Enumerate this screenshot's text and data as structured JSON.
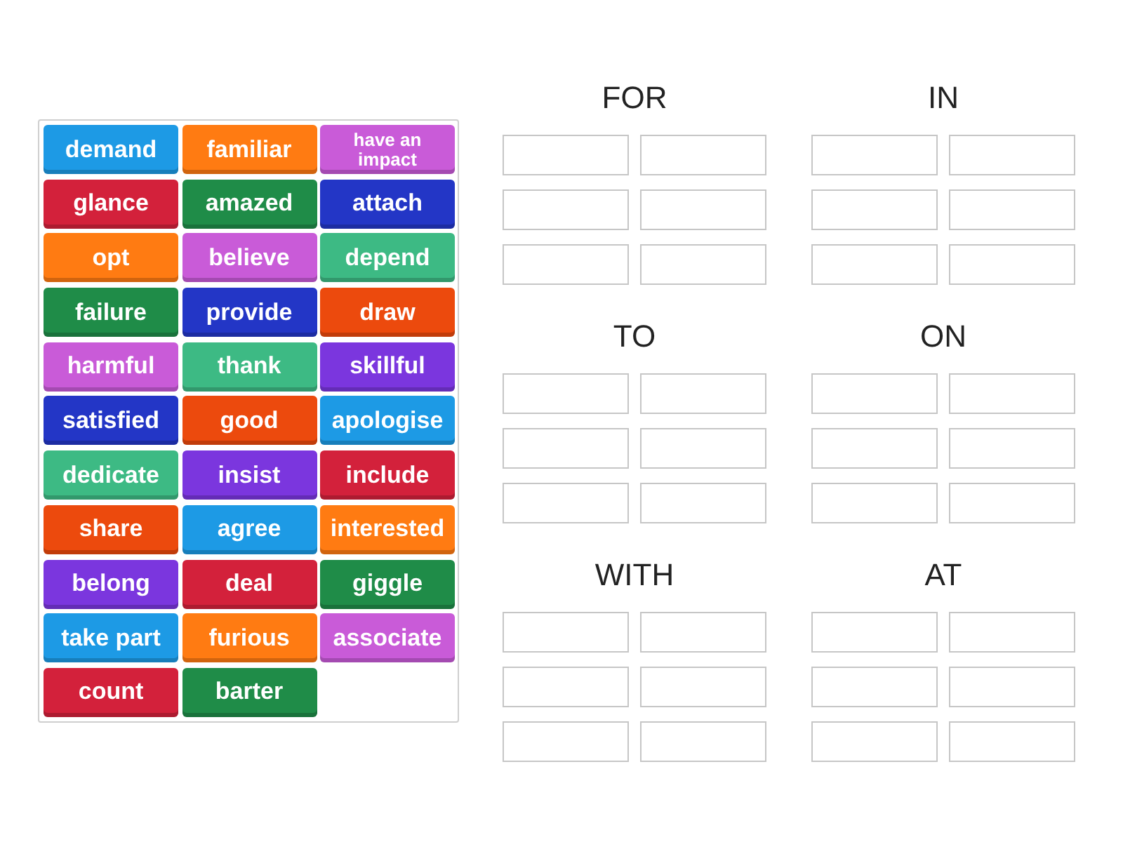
{
  "word_tiles": [
    {
      "text": "demand",
      "color": "#1d9ae5",
      "kind": "regular"
    },
    {
      "text": "familiar",
      "color": "#ff7b12",
      "kind": "regular"
    },
    {
      "text": "have an impact",
      "color": "#c95bd8",
      "kind": "compact"
    },
    {
      "text": "glance",
      "color": "#d3213b",
      "kind": "regular"
    },
    {
      "text": "amazed",
      "color": "#1f8c48",
      "kind": "regular"
    },
    {
      "text": "attach",
      "color": "#2336c6",
      "kind": "regular"
    },
    {
      "text": "opt",
      "color": "#ff7b12",
      "kind": "regular"
    },
    {
      "text": "believe",
      "color": "#c95bd8",
      "kind": "regular"
    },
    {
      "text": "depend",
      "color": "#3dba84",
      "kind": "regular"
    },
    {
      "text": "failure",
      "color": "#1f8c48",
      "kind": "regular"
    },
    {
      "text": "provide",
      "color": "#2336c6",
      "kind": "regular"
    },
    {
      "text": "draw",
      "color": "#ec4a0d",
      "kind": "regular"
    },
    {
      "text": "harmful",
      "color": "#c95bd8",
      "kind": "regular"
    },
    {
      "text": "thank",
      "color": "#3dba84",
      "kind": "regular"
    },
    {
      "text": "skillful",
      "color": "#7b36de",
      "kind": "regular"
    },
    {
      "text": "satisfied",
      "color": "#2336c6",
      "kind": "regular"
    },
    {
      "text": "good",
      "color": "#ec4a0d",
      "kind": "regular"
    },
    {
      "text": "apologise",
      "color": "#1d9ae5",
      "kind": "regular"
    },
    {
      "text": "dedicate",
      "color": "#3dba84",
      "kind": "regular"
    },
    {
      "text": "insist",
      "color": "#7b36de",
      "kind": "regular"
    },
    {
      "text": "include",
      "color": "#d3213b",
      "kind": "regular"
    },
    {
      "text": "share",
      "color": "#ec4a0d",
      "kind": "regular"
    },
    {
      "text": "agree",
      "color": "#1d9ae5",
      "kind": "regular"
    },
    {
      "text": "interested",
      "color": "#ff7b12",
      "kind": "regular"
    },
    {
      "text": "belong",
      "color": "#7b36de",
      "kind": "regular"
    },
    {
      "text": "deal",
      "color": "#d3213b",
      "kind": "regular"
    },
    {
      "text": "giggle",
      "color": "#1f8c48",
      "kind": "regular"
    },
    {
      "text": "take part",
      "color": "#1d9ae5",
      "kind": "regular"
    },
    {
      "text": "furious",
      "color": "#ff7b12",
      "kind": "regular"
    },
    {
      "text": "associate",
      "color": "#c95bd8",
      "kind": "regular"
    },
    {
      "text": "count",
      "color": "#d3213b",
      "kind": "regular"
    },
    {
      "text": "barter",
      "color": "#1f8c48",
      "kind": "regular"
    }
  ],
  "groups": [
    {
      "heading": "FOR"
    },
    {
      "heading": "IN"
    },
    {
      "heading": "TO"
    },
    {
      "heading": "ON"
    },
    {
      "heading": "WITH"
    },
    {
      "heading": "AT"
    }
  ]
}
